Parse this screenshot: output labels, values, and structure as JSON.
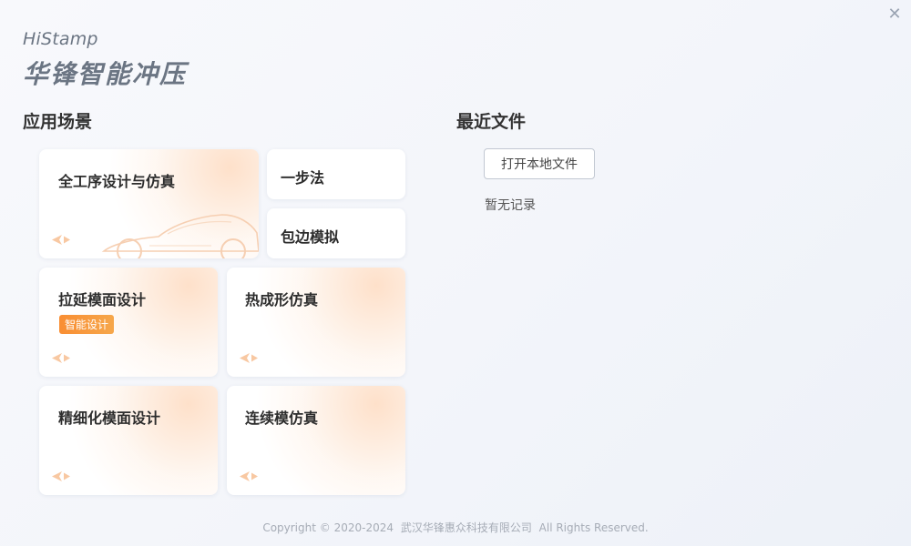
{
  "window": {
    "close_symbol": "✕"
  },
  "brand": {
    "name_en": "HiStamp",
    "name_cn": "华锋智能冲压"
  },
  "scenes": {
    "title": "应用场景",
    "cards": [
      {
        "label": "全工序设计与仿真"
      },
      {
        "label": "一步法"
      },
      {
        "label": "包边模拟"
      },
      {
        "label": "拉延模面设计",
        "badge": "智能设计"
      },
      {
        "label": "热成形仿真"
      },
      {
        "label": "精细化模面设计"
      },
      {
        "label": "连续模仿真"
      }
    ]
  },
  "recent": {
    "title": "最近文件",
    "open_button": "打开本地文件",
    "empty_text": "暂无记录"
  },
  "footer": {
    "copyright": "Copyright ©  2020-2024",
    "company": "武汉华锋惠众科技有限公司",
    "rights": "All Rights Reserved."
  },
  "colors": {
    "accent_orange": "#f98e33",
    "brand_gray": "#6b7583",
    "card_glow": "#fdd6b8"
  },
  "icons": {
    "card_arrow": "arrow-icon",
    "close": "close-icon",
    "car": "car-silhouette-icon"
  }
}
